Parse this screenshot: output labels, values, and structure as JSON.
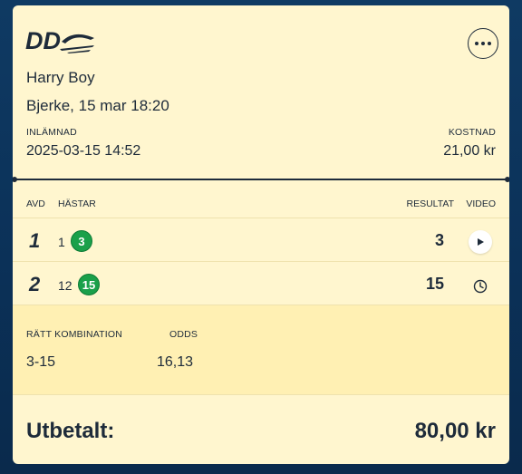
{
  "brand": {
    "logo_text": "DD"
  },
  "ticket": {
    "horse": "Harry Boy",
    "race": "Bjerke, 15 mar 18:20",
    "submitted_label": "INLÄMNAD",
    "submitted_value": "2025-03-15 14:52",
    "cost_label": "KOSTNAD",
    "cost_value": "21,00 kr"
  },
  "table": {
    "headers": {
      "avd": "AVD",
      "horses": "HÄSTAR",
      "result": "RESULTAT",
      "video": "VIDEO"
    },
    "rows": [
      {
        "avd": "1",
        "horse_num": "1",
        "badge": "3",
        "result": "3",
        "video_icon": "play-icon"
      },
      {
        "avd": "2",
        "horse_num": "12",
        "badge": "15",
        "result": "15",
        "video_icon": "clock-icon"
      }
    ]
  },
  "combo": {
    "label": "RÄTT KOMBINATION",
    "value": "3-15",
    "odds_label": "ODDS",
    "odds_value": "16,13"
  },
  "payout": {
    "label": "Utbetalt:",
    "value": "80,00 kr"
  },
  "colors": {
    "card_bg": "#fff6cf",
    "badge_green": "#1aa04a",
    "page_bg": "#0b3158",
    "text": "#1e2b3a"
  }
}
